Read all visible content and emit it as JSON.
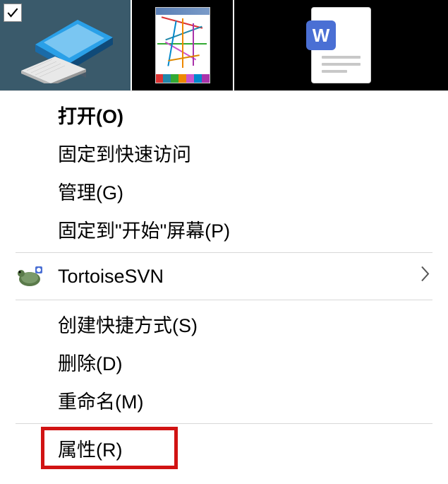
{
  "thumbnails": {
    "selected_checked": true,
    "doc_badge": "W"
  },
  "menu": {
    "open": "打开(O)",
    "pin_quick_access": "固定到快速访问",
    "manage": "管理(G)",
    "pin_start": "固定到\"开始\"屏幕(P)",
    "tortoisesvn": "TortoiseSVN",
    "create_shortcut": "创建快捷方式(S)",
    "delete": "删除(D)",
    "rename": "重命名(M)",
    "properties": "属性(R)"
  }
}
